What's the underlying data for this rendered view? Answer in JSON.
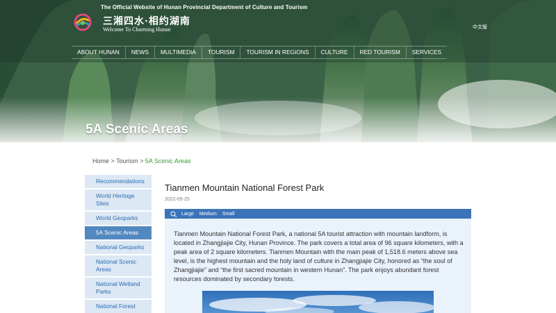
{
  "header": {
    "site_title": "The Official Website of Hunan Provincial Department of Culture and Tourism",
    "logo_cn": "三湘四水·相约湖南",
    "logo_en": "Welcome To Charming Hunan",
    "lang_link": "中文版"
  },
  "nav": {
    "items": [
      "ABOUT HUNAN",
      "NEWS",
      "MULTIMEDIA",
      "TOURISM",
      "TOURISM IN REGIONS",
      "CULTURE",
      "RED TOURISM",
      "SERVICES"
    ]
  },
  "hero": {
    "title": "5A Scenic Areas"
  },
  "breadcrumb": {
    "home": "Home",
    "sep1": " > ",
    "level1": "Tourism",
    "sep2": " > ",
    "current": "5A Scenic Areas"
  },
  "sidebar": {
    "items": [
      {
        "label": "Recommendations"
      },
      {
        "label": "World Heritage Sites"
      },
      {
        "label": "World Geoparks"
      },
      {
        "label": "5A Scenic Areas",
        "active": true
      },
      {
        "label": "National Geoparks"
      },
      {
        "label": "National Scenic Areas"
      },
      {
        "label": "National Wetland Parks"
      },
      {
        "label": "National Forest"
      }
    ]
  },
  "article": {
    "title": "Tianmen Mountain National Forest Park",
    "date": "2022-05-25",
    "font_options": [
      "Large",
      "Medium",
      "Small"
    ],
    "body": "Tianmen Mountain National Forest Park, a national 5A tourist attraction with mountain landform, is located in Zhangjiajie City, Hunan Province. The park covers a total area of 96 square kilometers, with a peak area of 2 square kilometers. Tianmen Mountain with the main peak of 1,518.6 meters above sea level, is the highest mountain and the holy land of culture in Zhangjiajie City, honored as “the soul of Zhangjiajie” and “the first sacred mountain in western Hunan”. The park enjoys abundant forest resources dominated by secondary forests."
  },
  "colors": {
    "nav_blue": "#3b74b8",
    "sidebar_bg": "#dce8f4",
    "sidebar_active": "#5288c0",
    "breadcrumb_current": "#3f9a36"
  }
}
